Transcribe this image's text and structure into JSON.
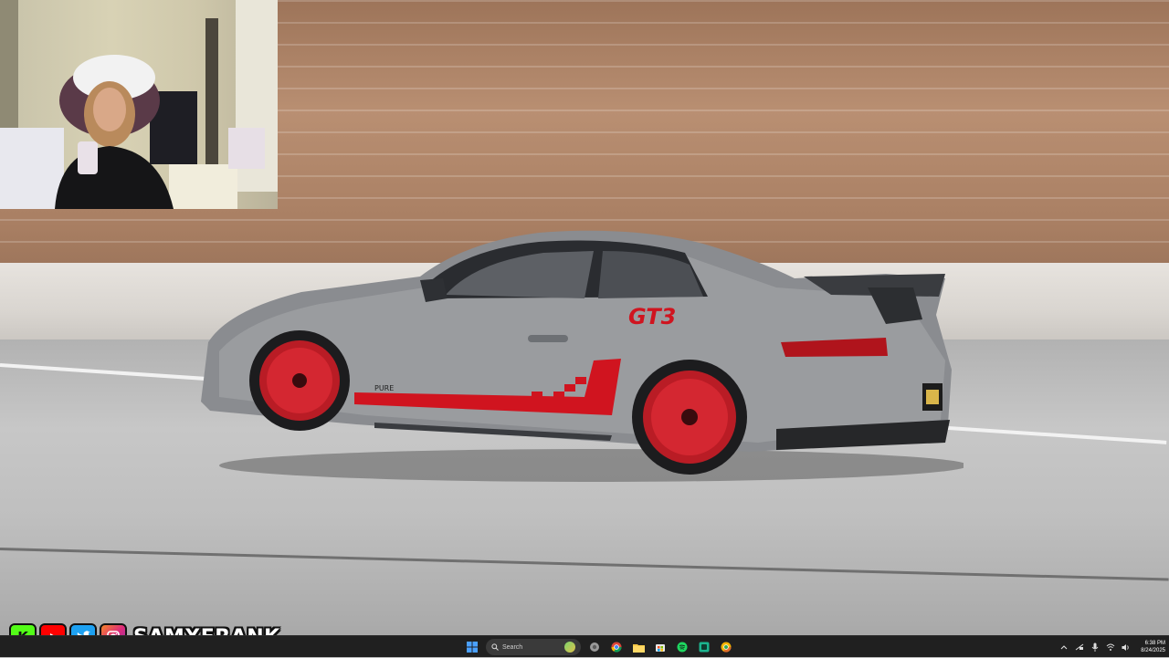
{
  "desktop": {
    "car_badge_text": "GT3",
    "door_decal_text": "PURE"
  },
  "overlay": {
    "social_handle": "SAMXFRANK",
    "kick_letter": "K"
  },
  "taskbar": {
    "search_placeholder": "Search",
    "pinned_apps": [
      "start-icon",
      "search-box",
      "task-view-icon",
      "chrome-icon",
      "file-explorer-icon",
      "store-icon",
      "spotify-icon",
      "terminal-icon",
      "chrome-canary-icon"
    ],
    "time": "6:38 PM",
    "date": "8/24/2025",
    "colors": {
      "taskbar_bg": "#202020",
      "accent": "#4aa0ff"
    }
  },
  "tray": {
    "icons": [
      "chevron-up-icon",
      "network-icon",
      "microphone-icon",
      "wifi-icon",
      "speaker-icon"
    ]
  }
}
